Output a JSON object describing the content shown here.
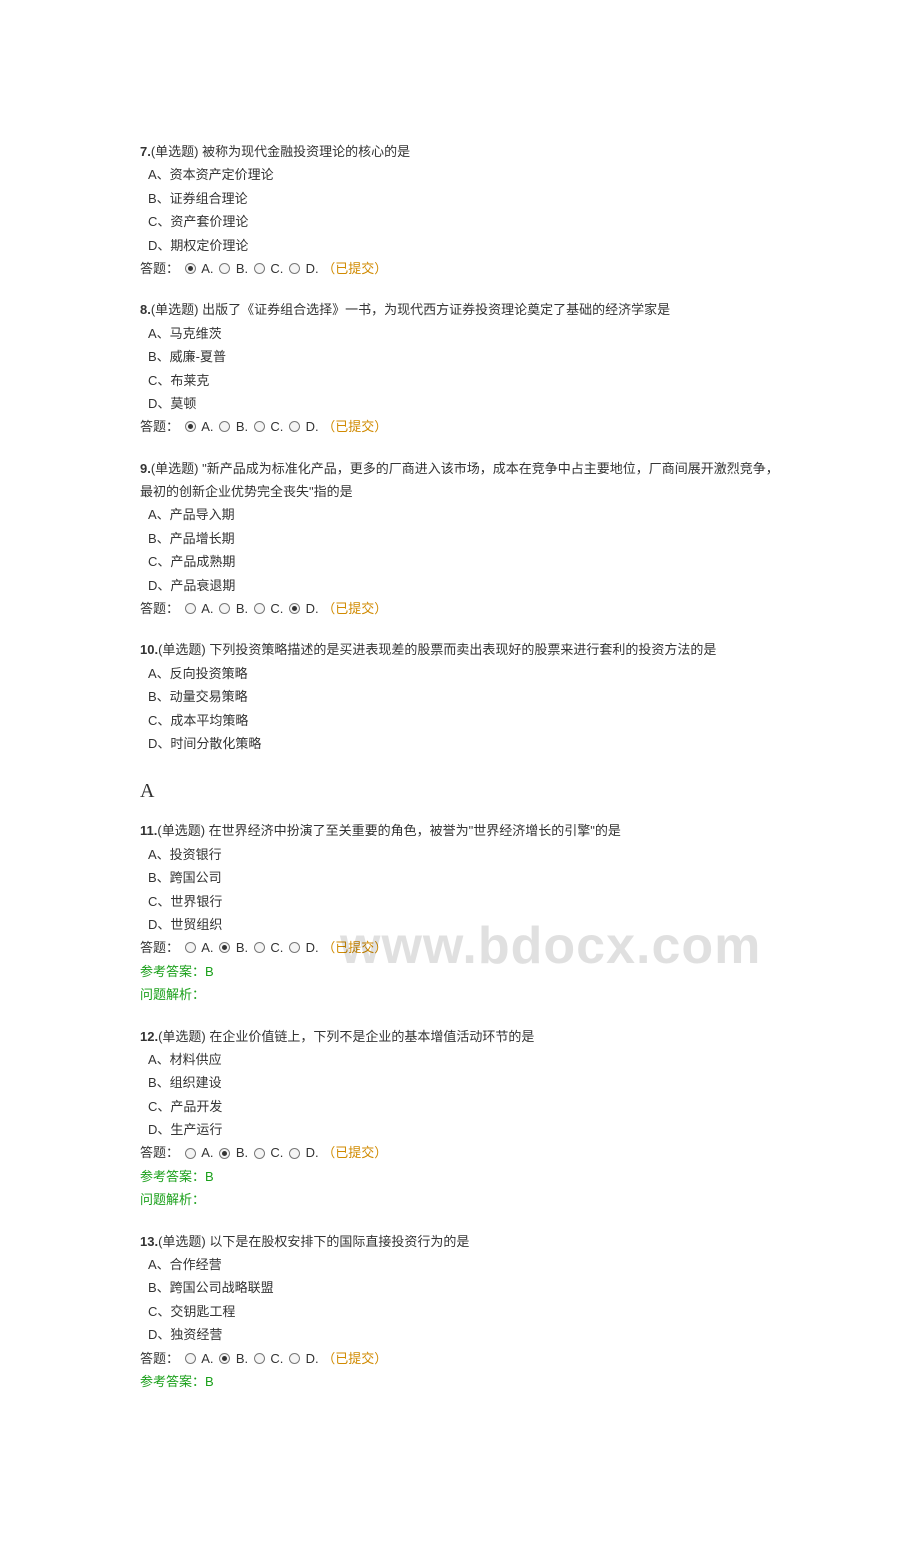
{
  "watermark": "www.bdocx.com",
  "labels": {
    "type_single": "(单选题)",
    "answer_prefix": "答题：",
    "submitted": "（已提交）",
    "ref_answer_prefix": "参考答案：",
    "explain_prefix": "问题解析：",
    "opt_a": "A.",
    "opt_b": "B.",
    "opt_c": "C.",
    "opt_d": "D."
  },
  "big_letter": "A",
  "questions": [
    {
      "num": "7.",
      "text": "被称为现代金融投资理论的核心的是",
      "options": [
        "A、资本资产定价理论",
        "B、证券组合理论",
        "C、资产套价理论",
        "D、期权定价理论"
      ],
      "selected": "A"
    },
    {
      "num": "8.",
      "text": "出版了《证券组合选择》一书，为现代西方证券投资理论奠定了基础的经济学家是",
      "options": [
        "A、马克维茨",
        "B、威廉-夏普",
        "C、布莱克",
        "D、莫顿"
      ],
      "selected": "A"
    },
    {
      "num": "9.",
      "text": "\"新产品成为标准化产品，更多的厂商进入该市场，成本在竞争中占主要地位，厂商间展开激烈竞争，最初的创新企业优势完全丧失\"指的是",
      "options": [
        "A、产品导入期",
        "B、产品增长期",
        "C、产品成熟期",
        "D、产品衰退期"
      ],
      "selected": "D"
    },
    {
      "num": "10.",
      "text": "下列投资策略描述的是买进表现差的股票而卖出表现好的股票来进行套利的投资方法的是",
      "options": [
        "A、反向投资策略",
        "B、动量交易策略",
        "C、成本平均策略",
        "D、时间分散化策略"
      ]
    },
    {
      "num": "11.",
      "text": "在世界经济中扮演了至关重要的角色，被誉为\"世界经济增长的引擎\"的是",
      "options": [
        "A、投资银行",
        "B、跨国公司",
        "C、世界银行",
        "D、世贸组织"
      ],
      "selected": "B",
      "ref_answer": "B",
      "show_explain": true
    },
    {
      "num": "12.",
      "text": "在企业价值链上，下列不是企业的基本增值活动环节的是",
      "options": [
        "A、材料供应",
        "B、组织建设",
        "C、产品开发",
        "D、生产运行"
      ],
      "selected": "B",
      "ref_answer": "B",
      "show_explain": true
    },
    {
      "num": "13.",
      "text": "以下是在股权安排下的国际直接投资行为的是",
      "options": [
        "A、合作经营",
        "B、跨国公司战略联盟",
        "C、交钥匙工程",
        "D、独资经营"
      ],
      "selected": "B",
      "ref_answer": "B"
    }
  ]
}
